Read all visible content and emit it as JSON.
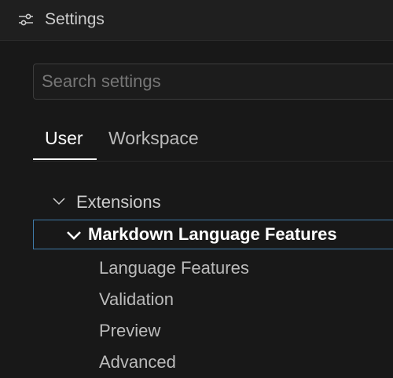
{
  "header": {
    "title": "Settings",
    "icon": "settings-sliders-icon"
  },
  "search": {
    "placeholder": "Search settings",
    "value": ""
  },
  "tabs": [
    {
      "label": "User",
      "active": true
    },
    {
      "label": "Workspace",
      "active": false
    }
  ],
  "tree": {
    "root": {
      "label": "Extensions",
      "expanded": true
    },
    "group": {
      "label": "Markdown Language Features",
      "expanded": true,
      "selected": true
    },
    "children": [
      {
        "label": "Language Features"
      },
      {
        "label": "Validation"
      },
      {
        "label": "Preview"
      },
      {
        "label": "Advanced"
      }
    ]
  },
  "colors": {
    "background": "#181818",
    "title_bar": "#1f1f1f",
    "focus_border": "#3f7aa8",
    "active_tab": "#ffffff"
  }
}
